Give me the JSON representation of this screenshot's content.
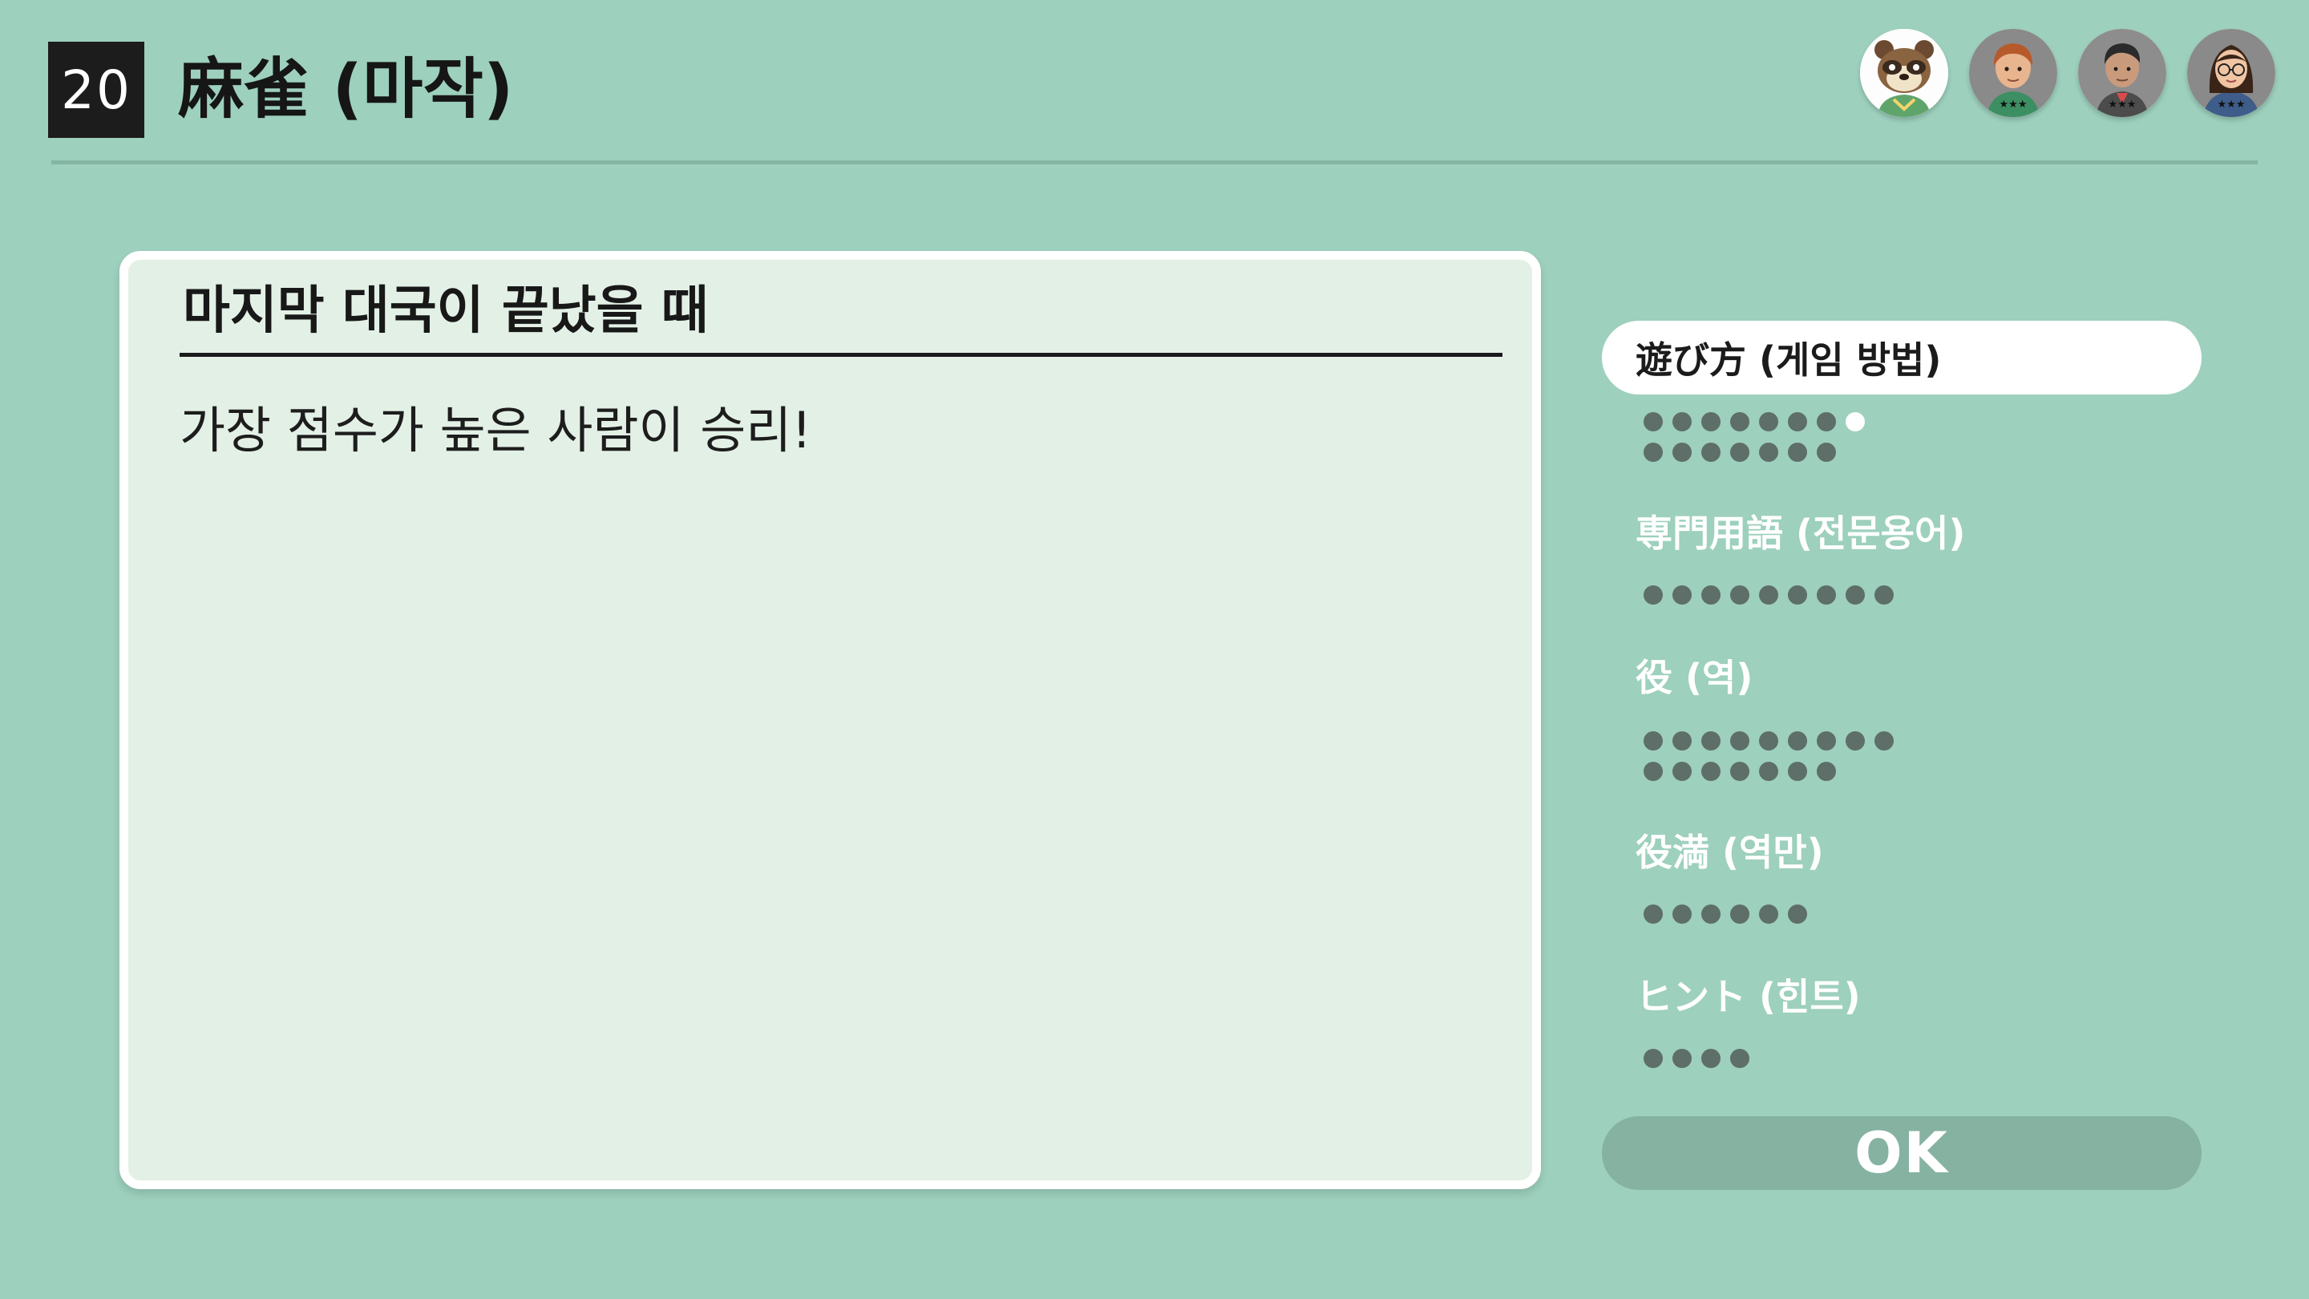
{
  "header": {
    "game_number": "20",
    "game_title": "麻雀 (마작)"
  },
  "players": [
    {
      "icon": "tanuki-villager-avatar-icon"
    },
    {
      "icon": "red-haired-player-avatar-icon",
      "stars": "★★★"
    },
    {
      "icon": "dark-haired-player-avatar-icon",
      "stars": "★★★"
    },
    {
      "icon": "glasses-player-avatar-icon",
      "stars": "★★★"
    }
  ],
  "content": {
    "title": "마지막 대국이 끝났을 때",
    "body": "가장 점수가 높은 사람이 승리!"
  },
  "menu": {
    "items": [
      {
        "label": "遊び方 (게임 방법)",
        "active": true,
        "pages": 15,
        "current_page": 8
      },
      {
        "label": "専門用語 (전문용어)",
        "active": false,
        "pages": 9
      },
      {
        "label": "役 (역)",
        "active": false,
        "pages": 16
      },
      {
        "label": "役満 (역만)",
        "active": false,
        "pages": 6
      },
      {
        "label": "ヒント (힌트)",
        "active": false,
        "pages": 4
      }
    ],
    "ok_label": "OK"
  },
  "colors": {
    "background": "#9dd0bd",
    "card": "#e3f0e6",
    "dot": "#5e6e69",
    "dot_current": "#ffffff",
    "ok_button": "#86b2a1"
  }
}
